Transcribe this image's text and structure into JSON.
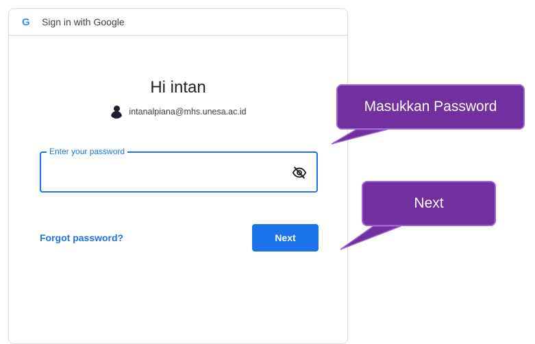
{
  "header": {
    "logo_letter": "G",
    "title": "Sign in with Google"
  },
  "account": {
    "greeting": "Hi intan",
    "email": "intanalpiana@mhs.unesa.ac.id"
  },
  "password_field": {
    "label": "Enter your password",
    "value": "",
    "placeholder": ""
  },
  "actions": {
    "forgot_label": "Forgot password?",
    "next_label": "Next"
  },
  "annotations": {
    "callout_password": "Masukkan Password",
    "callout_next": "Next"
  },
  "colors": {
    "primary": "#1a73e8",
    "callout_fill": "#7030a0",
    "callout_border": "#9966cc"
  },
  "icons": {
    "logo": "google-g-icon",
    "visibility": "eye-off-icon",
    "avatar": "user-avatar"
  }
}
